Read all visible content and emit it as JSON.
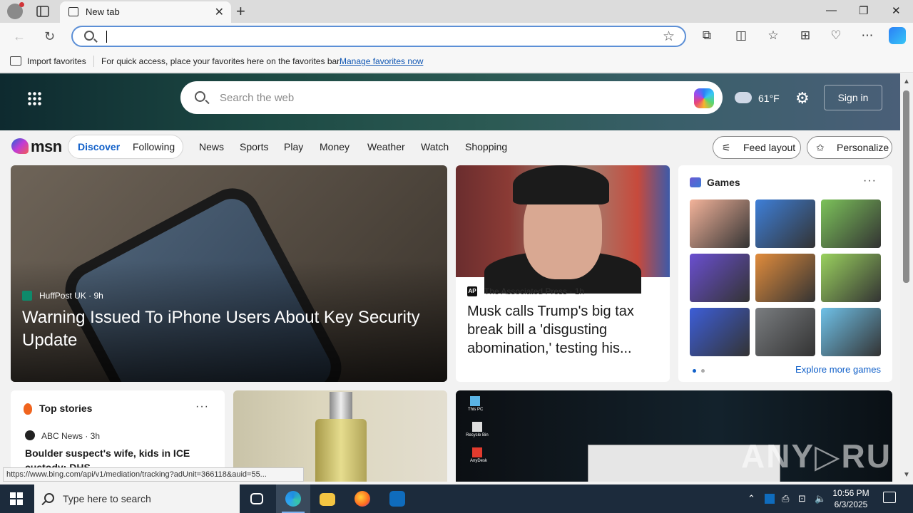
{
  "browser": {
    "tab_title": "New tab",
    "address_value": "",
    "window_controls": [
      "—",
      "❐",
      "✕"
    ]
  },
  "favorites_bar": {
    "import_label": "Import favorites",
    "message": "For quick access, place your favorites here on the favorites bar.",
    "manage_link": "Manage favorites now"
  },
  "msn": {
    "search_placeholder": "Search the web",
    "temperature": "61°F",
    "sign_in": "Sign in",
    "logo_text": "msn",
    "pill_tabs": [
      "Discover",
      "Following"
    ],
    "nav": [
      "News",
      "Sports",
      "Play",
      "Money",
      "Weather",
      "Watch",
      "Shopping"
    ],
    "feed_layout": "Feed layout",
    "personalize": "Personalize"
  },
  "cards": {
    "main": {
      "source": "HuffPost UK · 9h",
      "headline": "Warning Issued To iPhone Users About Key Security Update"
    },
    "news": {
      "source": "The Associated Press · 1h",
      "headline": "Musk calls Trump's big tax break bill a 'disgusting abomination,' testing his..."
    },
    "games": {
      "title": "Games",
      "explore": "Explore more games",
      "tile_colors": [
        "#f3b39a",
        "#3e7fd8",
        "#7cc25a",
        "#6a4fd0",
        "#e18c3c",
        "#9ad15e",
        "#3d5ed8",
        "#7a7d80",
        "#6fc1e8"
      ]
    },
    "top_stories": {
      "title": "Top stories",
      "source": "ABC News · 3h",
      "headline": "Boulder suspect's wife, kids in ICE custody: DHS"
    },
    "desktop": {
      "icons": [
        "This PC",
        "Recycle Bin",
        "AnyDesk"
      ],
      "watermark": "ANY▷RUN"
    }
  },
  "status_url": "https://www.bing.com/api/v1/mediation/tracking?adUnit=366118&auid=55...",
  "taskbar": {
    "search_text": "Type here to search",
    "time": "10:56 PM",
    "date": "6/3/2025"
  }
}
